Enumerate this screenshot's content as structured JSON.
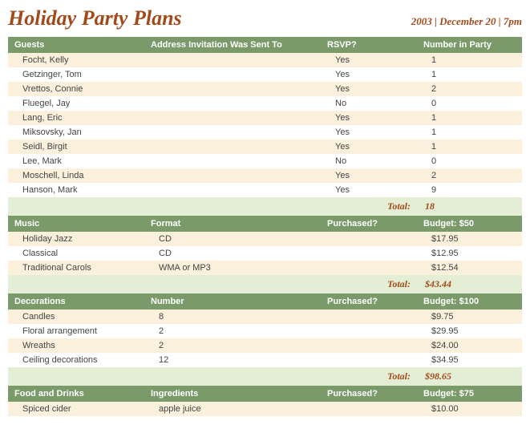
{
  "header": {
    "title": "Holiday Party Plans",
    "date_line": "2003 | December 20 | 7pm"
  },
  "sections": [
    {
      "headers": [
        "Guests",
        "Address Invitation Was Sent To",
        "RSVP?",
        "Number in Party"
      ],
      "rows": [
        [
          "Focht, Kelly",
          "",
          "Yes",
          "1"
        ],
        [
          "Getzinger, Tom",
          "",
          "Yes",
          "1"
        ],
        [
          "Vrettos, Connie",
          "",
          "Yes",
          "2"
        ],
        [
          "Fluegel, Jay",
          "",
          "No",
          "0"
        ],
        [
          "Lang, Eric",
          "",
          "Yes",
          "1"
        ],
        [
          "Miksovsky, Jan",
          "",
          "Yes",
          "1"
        ],
        [
          "Seidl, Birgit",
          "",
          "Yes",
          "1"
        ],
        [
          "Lee, Mark",
          "",
          "No",
          "0"
        ],
        [
          "Moschell, Linda",
          "",
          "Yes",
          "2"
        ],
        [
          "Hanson, Mark",
          "",
          "Yes",
          "9"
        ]
      ],
      "total_label": "Total:",
      "total_value": "18"
    },
    {
      "headers": [
        "Music",
        "Format",
        "Purchased?",
        "Budget: $50"
      ],
      "rows": [
        [
          "Holiday Jazz",
          "CD",
          "",
          "$17.95"
        ],
        [
          "Classical",
          "CD",
          "",
          "$12.95"
        ],
        [
          "Traditional Carols",
          "WMA or MP3",
          "",
          "$12.54"
        ]
      ],
      "total_label": "Total:",
      "total_value": "$43.44"
    },
    {
      "headers": [
        "Decorations",
        "Number",
        "Purchased?",
        "Budget: $100"
      ],
      "rows": [
        [
          "Candles",
          "8",
          "",
          "$9.75"
        ],
        [
          "Floral arrangement",
          "2",
          "",
          "$29.95"
        ],
        [
          "Wreaths",
          "2",
          "",
          "$24.00"
        ],
        [
          "Ceiling decorations",
          "12",
          "",
          "$34.95"
        ]
      ],
      "total_label": "Total:",
      "total_value": "$98.65"
    },
    {
      "headers": [
        "Food and Drinks",
        "Ingredients",
        "Purchased?",
        "Budget: $75"
      ],
      "rows": [
        [
          "Spiced cider",
          "apple juice",
          "",
          "$10.00"
        ]
      ],
      "total_label": "",
      "total_value": ""
    }
  ]
}
